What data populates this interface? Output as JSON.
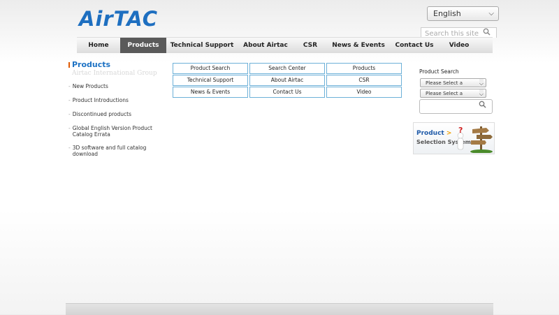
{
  "brand": {
    "logo_text": "AirTAC"
  },
  "language": {
    "selected": "English"
  },
  "search": {
    "placeholder": "Search this site"
  },
  "nav": {
    "items": [
      "Home",
      "Products",
      "Technical Support",
      "About Airtac",
      "CSR",
      "News & Events",
      "Contact Us",
      "Video"
    ],
    "active": "Products"
  },
  "sidebar": {
    "title": "Products",
    "subtitle": "Airtac International Group",
    "links": [
      "New Products",
      "Product Introductions",
      "Discontinued products",
      "Global English Version Product Catalog Errata",
      "3D software and full catalog download"
    ]
  },
  "grid": {
    "buttons": [
      "Product Search",
      "Search Center",
      "Products",
      "Technical Support",
      "About Airtac",
      "CSR",
      "News & Events",
      "Contact Us",
      "Video"
    ]
  },
  "product_search": {
    "label": "Product Search",
    "select1": "Please Select a Category",
    "select2": "Please Select a Category"
  },
  "banner": {
    "line1": "Product",
    "line1_suffix": ">",
    "line2": "Selection System"
  },
  "colors": {
    "brand_blue": "#1e6fc0",
    "accent_orange": "#e05a00",
    "nav_active": "#5a5a5a",
    "button_border": "#6cb0d8"
  }
}
